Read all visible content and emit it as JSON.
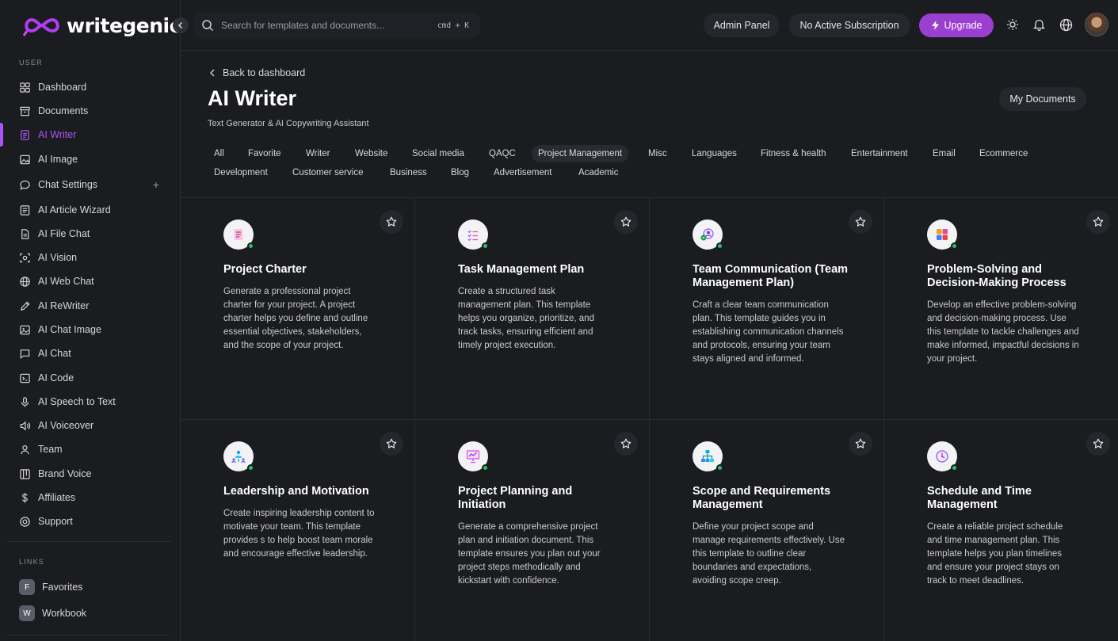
{
  "brand": {
    "name": "writegenic",
    "accent": "#a855f7"
  },
  "sidebar": {
    "user_label": "USER",
    "items": [
      {
        "label": "Dashboard",
        "icon": "grid-icon"
      },
      {
        "label": "Documents",
        "icon": "archive-icon"
      },
      {
        "label": "AI Writer",
        "icon": "document-icon",
        "active": true
      },
      {
        "label": "AI Image",
        "icon": "image-icon"
      },
      {
        "label": "Chat Settings",
        "icon": "chat-bubble-icon"
      },
      {
        "label": "AI Article Wizard",
        "icon": "article-icon"
      },
      {
        "label": "AI File Chat",
        "icon": "file-icon"
      },
      {
        "label": "AI Vision",
        "icon": "scan-icon"
      },
      {
        "label": "AI Web Chat",
        "icon": "globe-icon"
      },
      {
        "label": "AI ReWriter",
        "icon": "pen-icon"
      },
      {
        "label": "AI Chat Image",
        "icon": "chat-image-icon"
      },
      {
        "label": "AI Chat",
        "icon": "message-icon"
      },
      {
        "label": "AI Code",
        "icon": "terminal-icon"
      },
      {
        "label": "AI Speech to Text",
        "icon": "microphone-icon"
      },
      {
        "label": "AI Voiceover",
        "icon": "speaker-icon"
      },
      {
        "label": "Team",
        "icon": "user-icon"
      },
      {
        "label": "Brand Voice",
        "icon": "board-icon"
      },
      {
        "label": "Affiliates",
        "icon": "dollar-icon"
      },
      {
        "label": "Support",
        "icon": "lifebuoy-icon"
      }
    ],
    "links_label": "LINKS",
    "links": [
      {
        "badge": "F",
        "label": "Favorites"
      },
      {
        "badge": "W",
        "label": "Workbook"
      }
    ]
  },
  "topbar": {
    "search_placeholder": "Search for templates and documents...",
    "search_shortcut": "cmd + K",
    "admin_panel": "Admin Panel",
    "subscription": "No Active Subscription",
    "upgrade": "Upgrade"
  },
  "header": {
    "back": "Back to dashboard",
    "title": "AI Writer",
    "subtitle": "Text Generator & AI Copywriting Assistant",
    "my_documents": "My Documents"
  },
  "filters_row1": [
    "All",
    "Favorite",
    "Writer",
    "Website",
    "Social media",
    "QAQC",
    "Project Management",
    "Misc",
    "Languages",
    "Fitness & health",
    "Entertainment",
    "Email",
    "Ecommerce"
  ],
  "filters_row2": [
    "Development",
    "Customer service",
    "Business",
    "Blog",
    "Advertisement",
    "Academic"
  ],
  "active_filter": "Project Management",
  "cards": [
    {
      "title": "Project Charter",
      "desc": "Generate a professional project charter for your project. A project charter helps you define and outline essential objectives, stakeholders, and the scope of your project.",
      "icon": "charter-icon"
    },
    {
      "title": "Task Management Plan",
      "desc": "Create a structured task management plan. This template helps you organize, prioritize, and track tasks, ensuring efficient and timely project execution.",
      "icon": "checklist-icon"
    },
    {
      "title": "Team Communication (Team Management Plan)",
      "desc": "Craft a clear team communication plan. This template guides you in establishing communication channels and protocols, ensuring your team stays aligned and informed.",
      "icon": "team-icon"
    },
    {
      "title": "Problem-Solving and Decision-Making Process",
      "desc": "Develop an effective problem-solving and decision-making process. Use this template to tackle challenges and make informed, impactful decisions in your project.",
      "icon": "puzzle-icon"
    },
    {
      "title": "Leadership and Motivation",
      "desc": "Create inspiring leadership content to motivate your team. This template provides s to help boost team morale and encourage effective leadership.",
      "icon": "leader-icon"
    },
    {
      "title": "Project Planning and Initiation",
      "desc": "Generate a comprehensive project plan and initiation document. This template ensures you plan out your project steps methodically and kickstart with confidence.",
      "icon": "presentation-icon"
    },
    {
      "title": "Scope and Requirements Management",
      "desc": "Define your project scope and manage requirements effectively. Use this template to outline clear boundaries and expectations, avoiding scope creep.",
      "icon": "hierarchy-icon"
    },
    {
      "title": "Schedule and Time Management",
      "desc": "Create a reliable project schedule and time management plan. This template helps you plan timelines and ensure your project stays on track to meet deadlines.",
      "icon": "clock-icon"
    }
  ]
}
